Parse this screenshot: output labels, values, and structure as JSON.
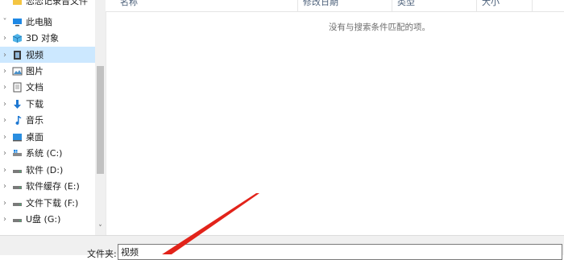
{
  "nav": {
    "top_partial_label": "恋恋记录音文件",
    "items": [
      {
        "label": "此电脑",
        "icon": "this-pc-icon",
        "expander": "˅"
      },
      {
        "label": "3D 对象",
        "icon": "3d-objects-icon",
        "expander": "›"
      },
      {
        "label": "视频",
        "icon": "videos-icon",
        "expander": "›",
        "selected": true
      },
      {
        "label": "图片",
        "icon": "pictures-icon",
        "expander": "›"
      },
      {
        "label": "文档",
        "icon": "documents-icon",
        "expander": "›"
      },
      {
        "label": "下载",
        "icon": "downloads-icon",
        "expander": "›"
      },
      {
        "label": "音乐",
        "icon": "music-icon",
        "expander": "›"
      },
      {
        "label": "桌面",
        "icon": "desktop-icon",
        "expander": "›"
      },
      {
        "label": "系统 (C:)",
        "icon": "system-drive-icon",
        "expander": "›"
      },
      {
        "label": "软件 (D:)",
        "icon": "drive-icon",
        "expander": "›"
      },
      {
        "label": "软件缓存 (E:)",
        "icon": "drive-icon",
        "expander": "›"
      },
      {
        "label": "文件下载 (F:)",
        "icon": "drive-icon",
        "expander": "›"
      },
      {
        "label": "U盘 (G:)",
        "icon": "usb-drive-icon",
        "expander": "›"
      }
    ]
  },
  "columns": [
    "名称",
    "修改日期",
    "类型",
    "大小"
  ],
  "empty_message": "没有与搜索条件匹配的项。",
  "filename": {
    "label": "文件夹:",
    "value": "视频"
  },
  "colors": {
    "selection": "#cce8ff",
    "arrow": "#e2231a",
    "folder": "#f4c542",
    "accent": "#1e88e5"
  }
}
